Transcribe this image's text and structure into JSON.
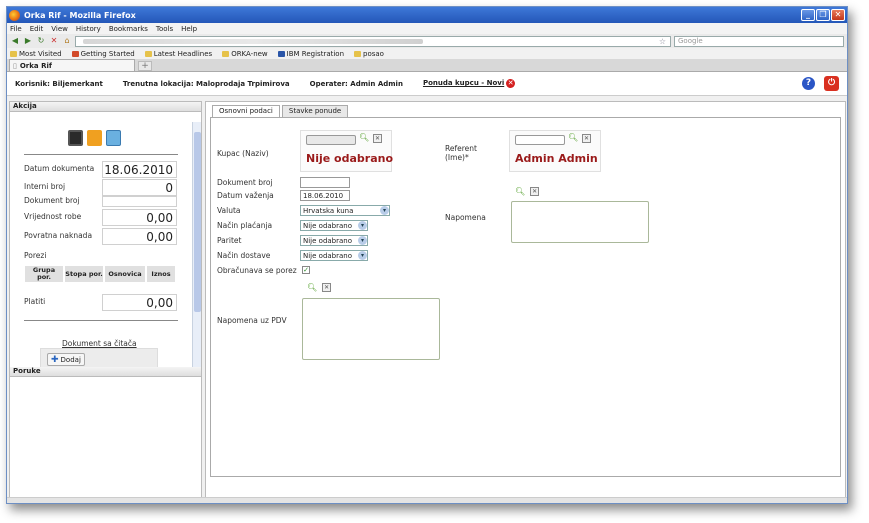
{
  "window": {
    "title": "Orka Rif - Mozilla Firefox"
  },
  "menu": [
    "File",
    "Edit",
    "View",
    "History",
    "Bookmarks",
    "Tools",
    "Help"
  ],
  "nav": {
    "search_placeholder": "Google"
  },
  "bookmarks": [
    "Most Visited",
    "Getting Started",
    "Latest Headlines",
    "ORKA-new",
    "IBM Registration",
    "posao"
  ],
  "browser_tab": {
    "label": "Orka Rif",
    "new_tab": "+"
  },
  "header": {
    "korisnik": "Korisnik: Biljemerkant",
    "lokacija": "Trenutna lokacija: Maloprodaja Trpimirova",
    "operater": "Operater: Admin Admin",
    "ponuda": "Ponuda kupcu - Novi"
  },
  "left_panel": {
    "title": "Akcija",
    "datum_label": "Datum dokumenta",
    "datum_value": "18.06.2010",
    "interni_label": "Interni broj",
    "interni_value": "0",
    "dokbroj_label": "Dokument broj",
    "vrijednost_label": "Vrijednost robe",
    "vrijednost_value": "0,00",
    "povratna_label": "Povratna naknada",
    "povratna_value": "0,00",
    "porezi_label": "Porezi",
    "porezi_columns": [
      "Grupa por.",
      "Stopa por.",
      "Osnovica",
      "Iznos"
    ],
    "platiti_label": "Platiti",
    "platiti_value": "0,00",
    "dokument_link": "Dokument sa čitača",
    "dodaj_label": "Dodaj",
    "poruke_title": "Poruke"
  },
  "main": {
    "tabs": [
      "Osnovni podaci",
      "Stavke ponude"
    ],
    "kupac_label": "Kupac (Naziv)",
    "kupac_value": "Nije odabrano",
    "referent_label": "Referent (Ime)*",
    "referent_value": "Admin Admin",
    "dokbroj_label": "Dokument broj",
    "datum_vazenja_label": "Datum važenja",
    "datum_vazenja_value": "18.06.2010",
    "valuta_label": "Valuta",
    "valuta_value": "Hrvatska kuna",
    "nacin_placanja_label": "Način plaćanja",
    "nacin_placanja_value": "Nije odabrano",
    "paritet_label": "Paritet",
    "paritet_value": "Nije odabrano",
    "nacin_dostave_label": "Način dostave",
    "nacin_dostave_value": "Nije odabrano",
    "obracunava_label": "Obračunava se porez",
    "napomena_label": "Napomena",
    "napomena_pdv_label": "Napomena uz PDV"
  }
}
